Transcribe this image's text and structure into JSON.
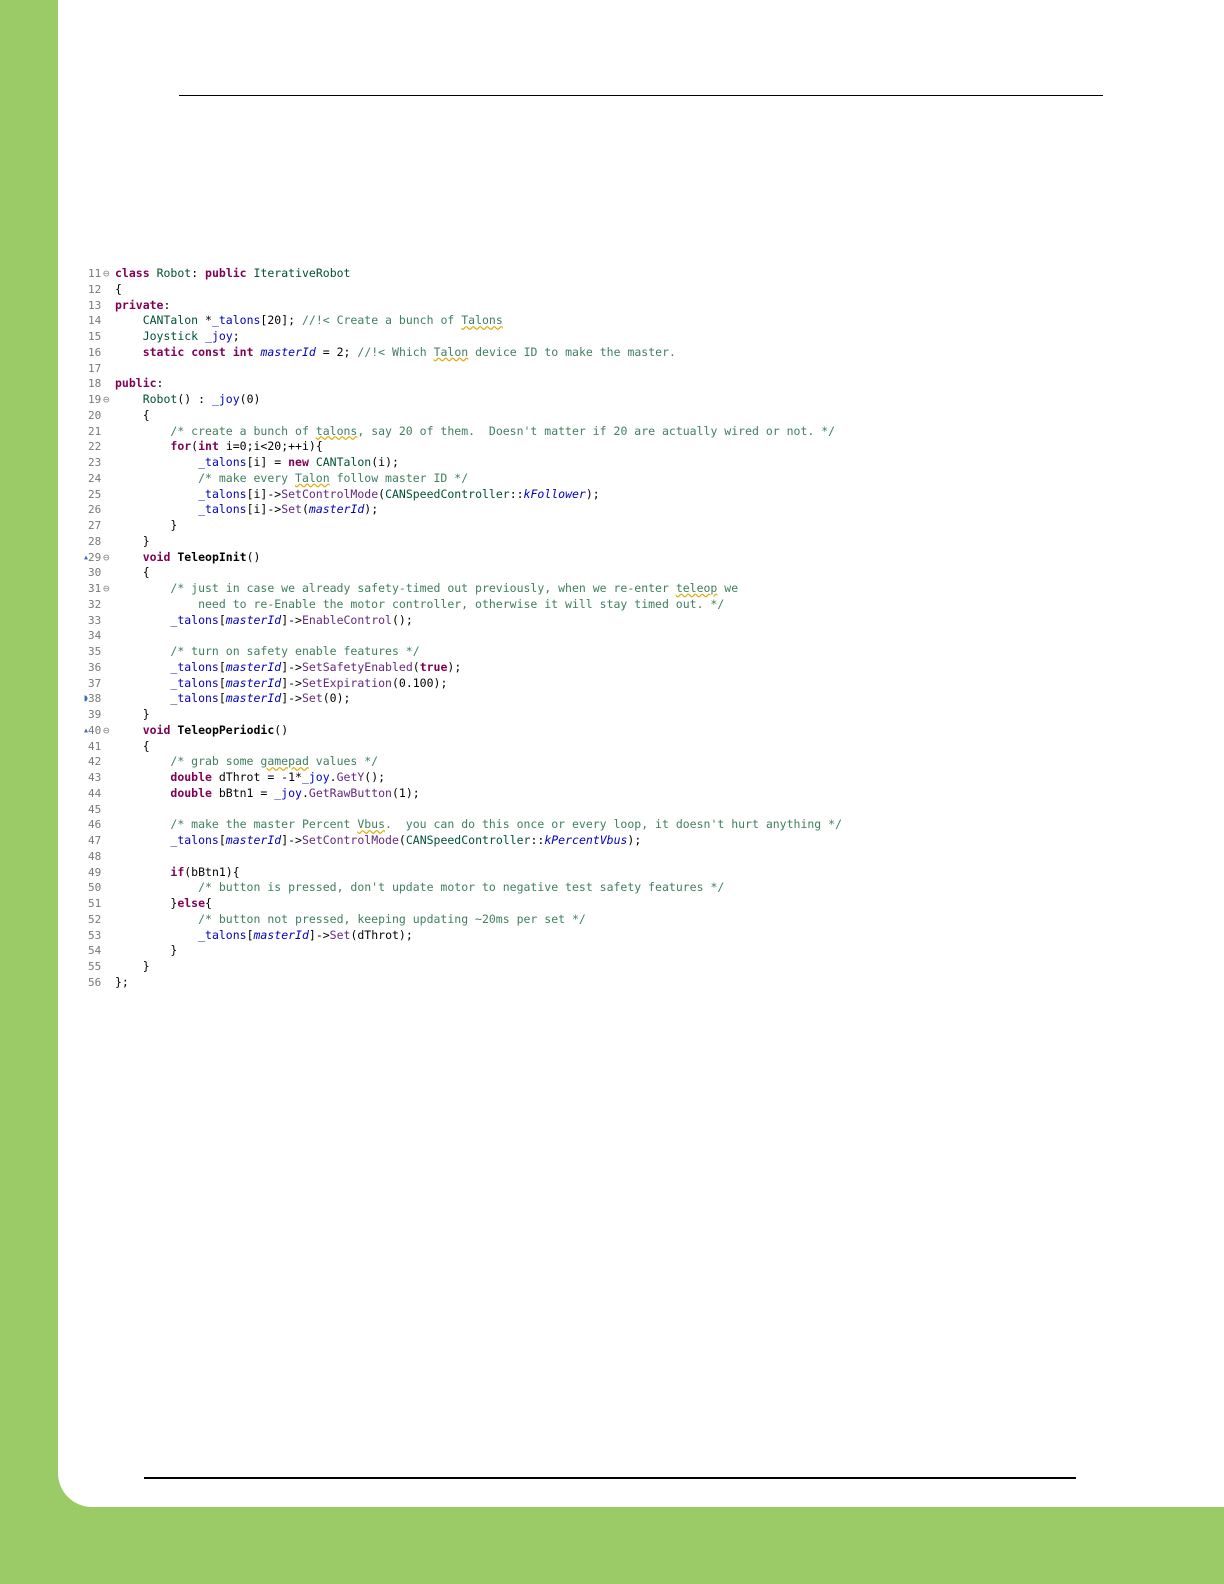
{
  "document": {
    "code_listing": {
      "lines": [
        {
          "num": "11",
          "fold": "⊖",
          "text": "class Robot: public IterativeRobot"
        },
        {
          "num": "12",
          "text": "{"
        },
        {
          "num": "13",
          "text": "private:"
        },
        {
          "num": "14",
          "text": "    CANTalon *_talons[20]; //!< Create a bunch of Talons"
        },
        {
          "num": "15",
          "text": "    Joystick _joy;"
        },
        {
          "num": "16",
          "text": "    static const int masterId = 2; //!< Which Talon device ID to make the master."
        },
        {
          "num": "17",
          "text": ""
        },
        {
          "num": "18",
          "text": "public:"
        },
        {
          "num": "19",
          "fold": "⊖",
          "text": "    Robot() : _joy(0)"
        },
        {
          "num": "20",
          "text": "    {"
        },
        {
          "num": "21",
          "text": "        /* create a bunch of talons, say 20 of them.  Doesn't matter if 20 are actually wired or not. */"
        },
        {
          "num": "22",
          "text": "        for(int i=0;i<20;++i){"
        },
        {
          "num": "23",
          "text": "            _talons[i] = new CANTalon(i);"
        },
        {
          "num": "24",
          "text": "            /* make every Talon follow master ID */"
        },
        {
          "num": "25",
          "text": "            _talons[i]->SetControlMode(CANSpeedController::kFollower);"
        },
        {
          "num": "26",
          "text": "            _talons[i]->Set(masterId);"
        },
        {
          "num": "27",
          "text": "        }"
        },
        {
          "num": "28",
          "text": "    }"
        },
        {
          "num": "29",
          "fold": "⊖",
          "marker": "▴",
          "text": "    void TeleopInit()"
        },
        {
          "num": "30",
          "text": "    {"
        },
        {
          "num": "31",
          "fold": "⊖",
          "text": "        /* just in case we already safety-timed out previously, when we re-enter teleop we"
        },
        {
          "num": "32",
          "text": "            need to re-Enable the motor controller, otherwise it will stay timed out. */"
        },
        {
          "num": "33",
          "text": "        _talons[masterId]->EnableControl();"
        },
        {
          "num": "34",
          "text": ""
        },
        {
          "num": "35",
          "text": "        /* turn on safety enable features */"
        },
        {
          "num": "36",
          "text": "        _talons[masterId]->SetSafetyEnabled(true);"
        },
        {
          "num": "37",
          "text": "        _talons[masterId]->SetExpiration(0.100);"
        },
        {
          "num": "38",
          "marker": "◗",
          "text": "        _talons[masterId]->Set(0);"
        },
        {
          "num": "39",
          "text": "    }"
        },
        {
          "num": "40",
          "fold": "⊖",
          "marker": "▴",
          "text": "    void TeleopPeriodic()"
        },
        {
          "num": "41",
          "text": "    {"
        },
        {
          "num": "42",
          "text": "        /* grab some gamepad values */"
        },
        {
          "num": "43",
          "text": "        double dThrot = -1*_joy.GetY();"
        },
        {
          "num": "44",
          "text": "        double bBtn1 = _joy.GetRawButton(1);"
        },
        {
          "num": "45",
          "text": ""
        },
        {
          "num": "46",
          "text": "        /* make the master Percent Vbus.  you can do this once or every loop, it doesn't hurt anything */"
        },
        {
          "num": "47",
          "text": "        _talons[masterId]->SetControlMode(CANSpeedController::kPercentVbus);"
        },
        {
          "num": "48",
          "text": ""
        },
        {
          "num": "49",
          "text": "        if(bBtn1){"
        },
        {
          "num": "50",
          "text": "            /* button is pressed, don't update motor to negative test safety features */"
        },
        {
          "num": "51",
          "text": "        }else{"
        },
        {
          "num": "52",
          "text": "            /* button not pressed, keeping updating ~20ms per set */"
        },
        {
          "num": "53",
          "text": "            _talons[masterId]->Set(dThrot);"
        },
        {
          "num": "54",
          "text": "        }"
        },
        {
          "num": "55",
          "text": "    }"
        },
        {
          "num": "56",
          "text": "};"
        }
      ]
    }
  },
  "colors": {
    "page_border": "#9bcb67",
    "keyword": "#7f0055",
    "type": "#005032",
    "comment": "#3f7f5f",
    "field": "#0000c0",
    "function": "#642880",
    "line_number": "#787878"
  }
}
